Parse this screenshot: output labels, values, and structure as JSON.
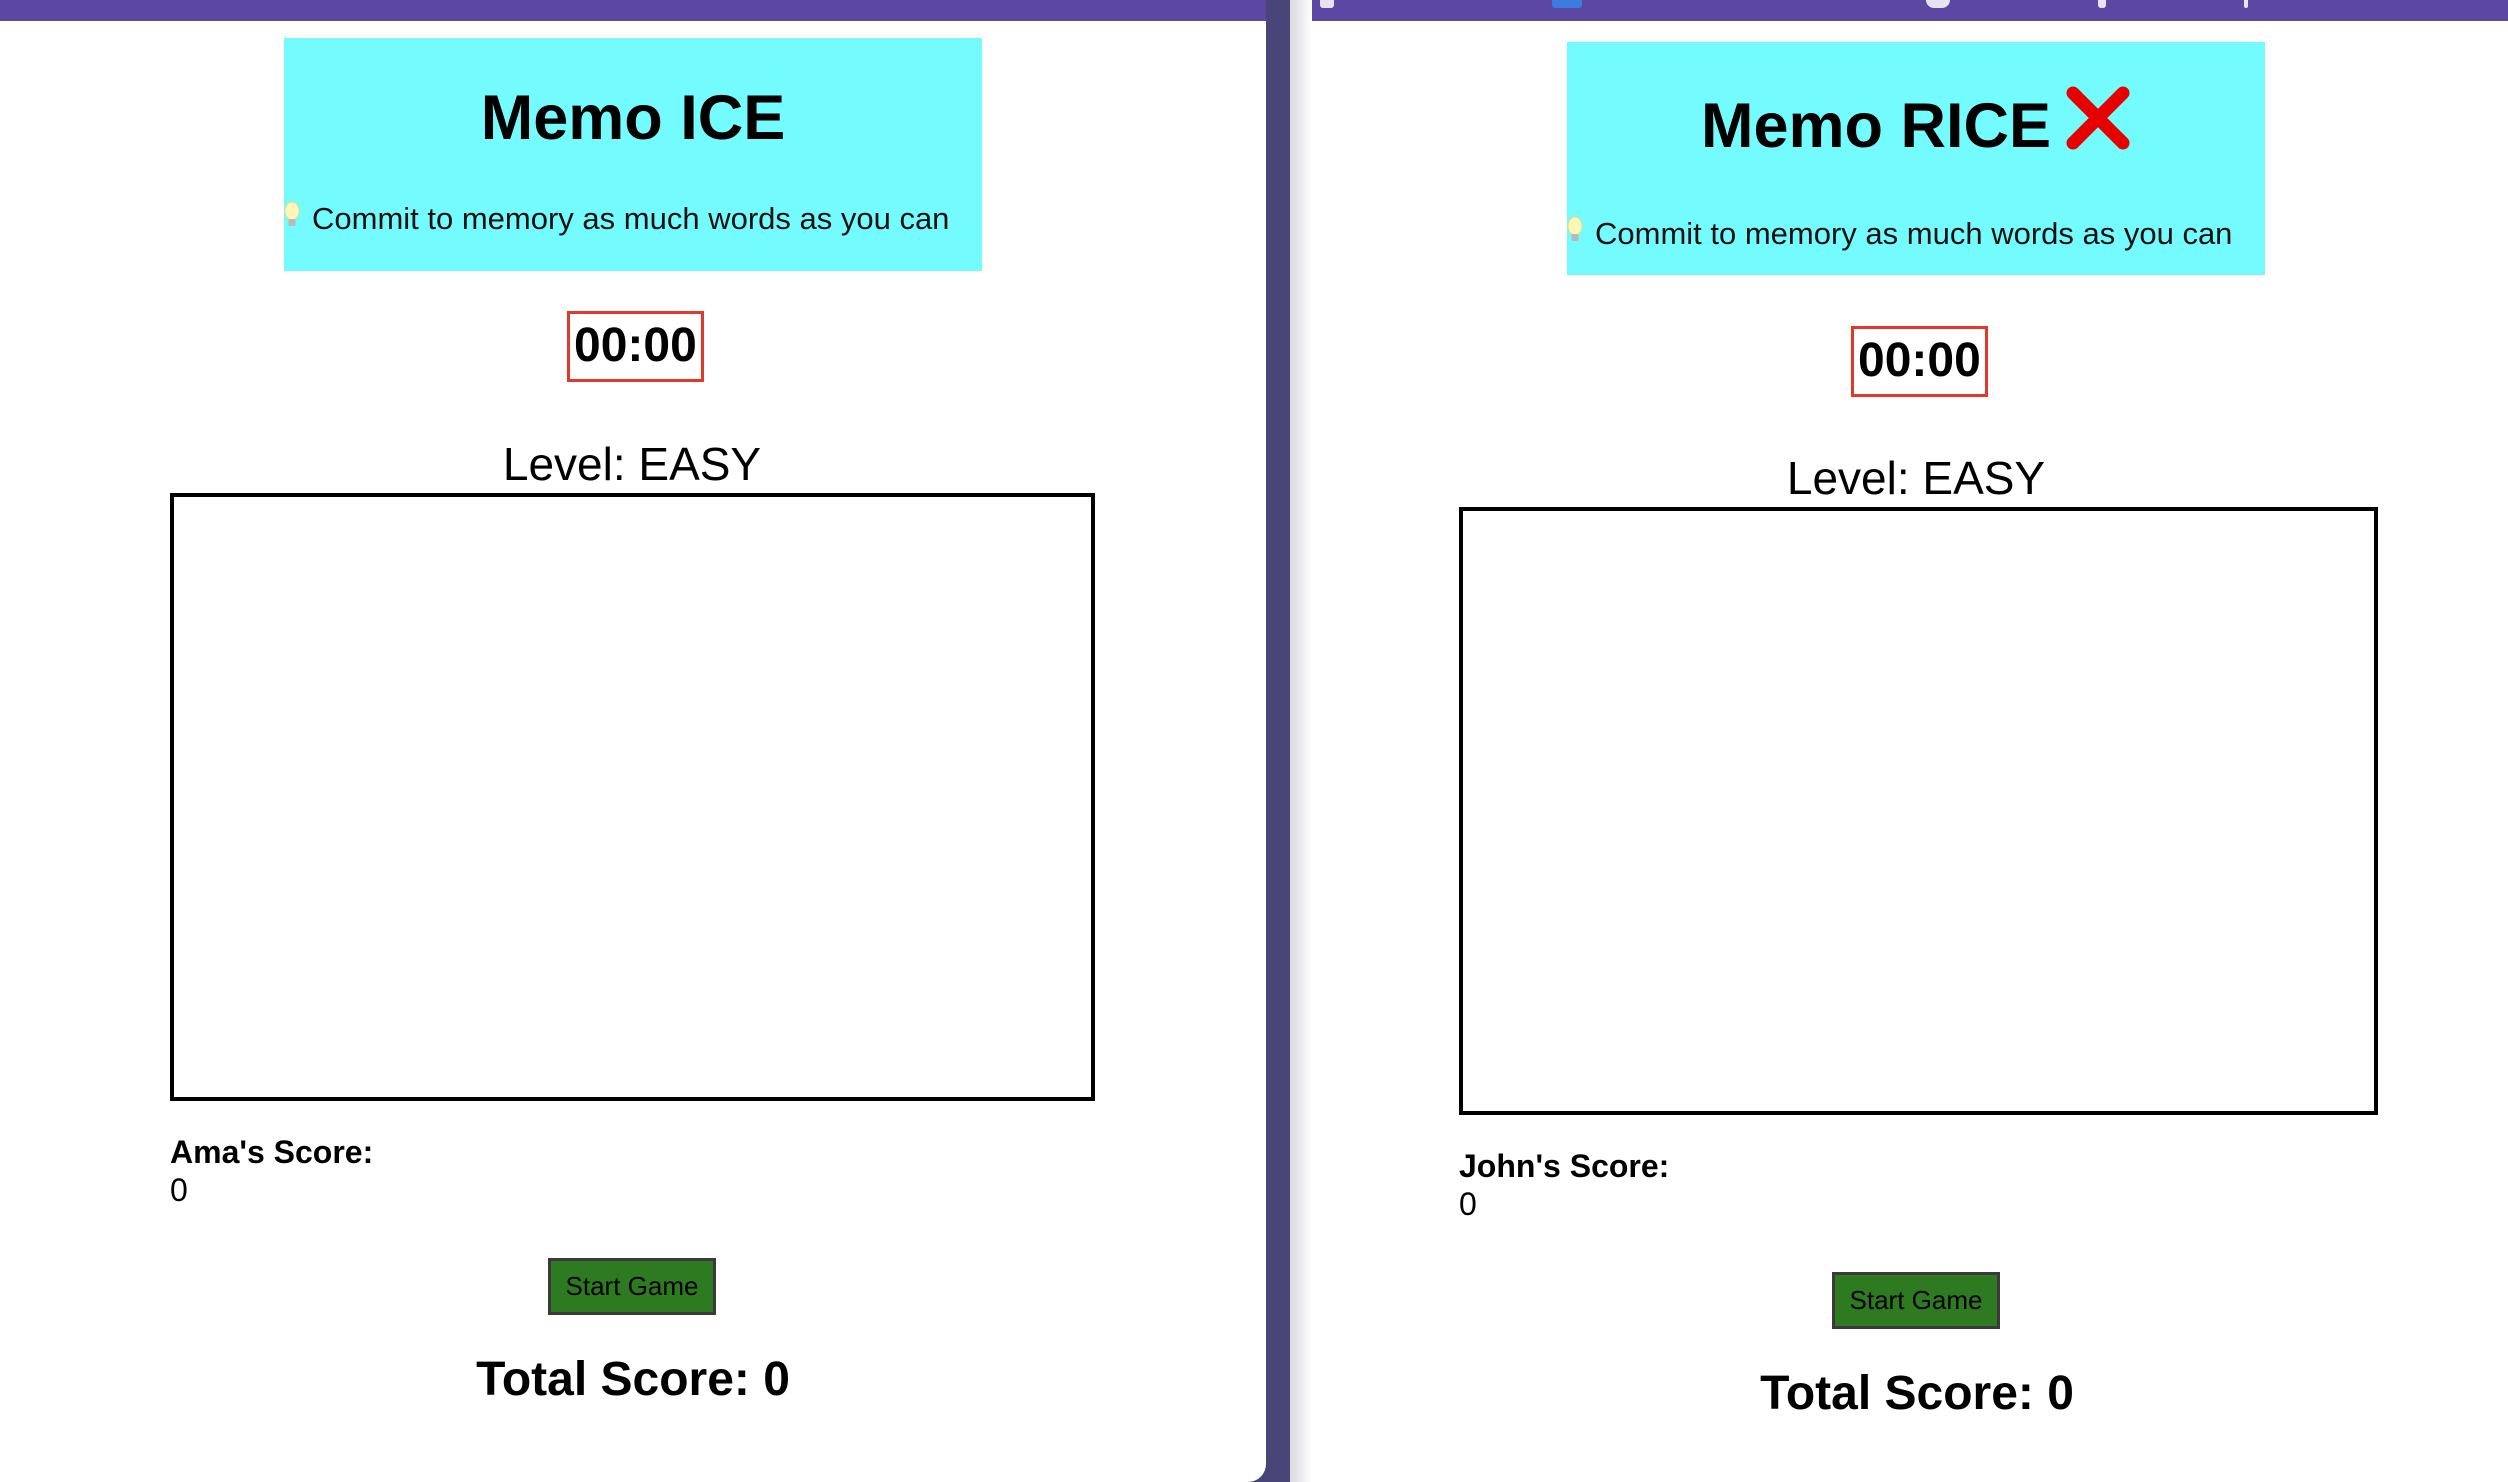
{
  "left_app": {
    "title": "Memo ICE",
    "subtitle": "Commit to memory as much words as you can",
    "timer": "00:00",
    "level": "Level: EASY",
    "player_score_label": "Ama's Score:",
    "player_score_value": "0",
    "start_button": "Start Game",
    "total_score": "Total Score: 0"
  },
  "right_app": {
    "title": "Memo RICE",
    "title_icon": "red-cross-mark-icon",
    "subtitle": "Commit to memory as much words as you can",
    "timer": "00:00",
    "level": "Level: EASY",
    "player_score_label": "John's Score:",
    "player_score_value": "0",
    "start_button": "Start Game",
    "total_score": "Total Score: 0"
  },
  "colors": {
    "header_bg": "#74fbfd",
    "timer_border": "#e23a2a",
    "button_bg": "#2e7a20",
    "topbar": "#5c47a3",
    "cross": "#e60000"
  },
  "icons": [
    "lightbulb-icon",
    "red-cross-mark-icon"
  ]
}
